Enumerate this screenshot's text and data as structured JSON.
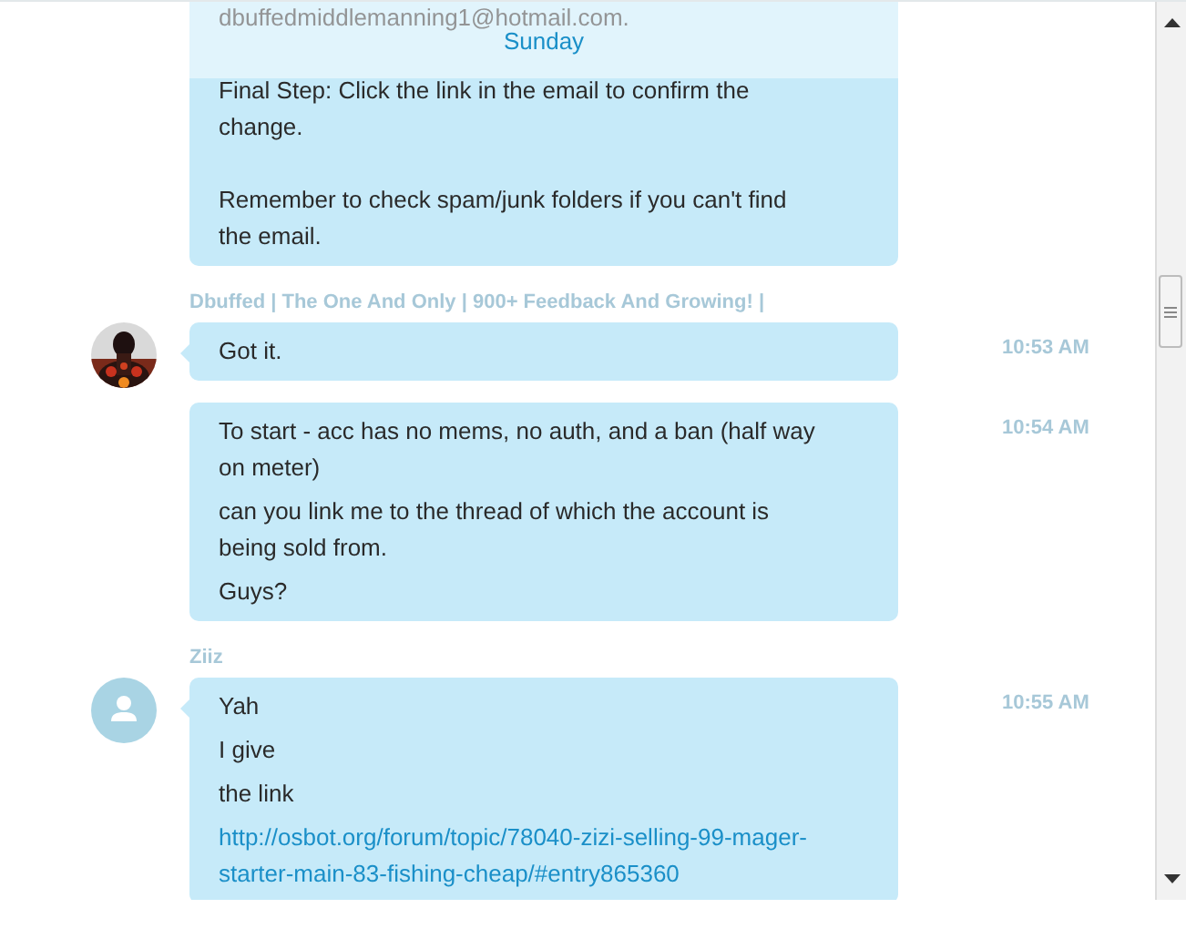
{
  "date_divider": "Sunday",
  "groups": [
    {
      "kind": "paragraphs",
      "bubbles": [
        {
          "messages": [
            {
              "kind": "text",
              "text": "dbuffedmiddlemanning1@hotmail.com."
            },
            {
              "kind": "text",
              "text": "Final Step: Click the link in the email to confirm the change."
            },
            {
              "kind": "text",
              "text": "Remember to check spam/junk folders if you can't find the email."
            }
          ]
        }
      ]
    },
    {
      "kind": "lines",
      "sender": "Dbuffed | The One And Only | 900+ Feedback And Growing! |",
      "avatar": {
        "kind": "picture"
      },
      "bubbles": [
        {
          "time": "10:53 AM",
          "messages": [
            {
              "kind": "text",
              "text": "Got it."
            }
          ]
        },
        {
          "time": "10:54 AM",
          "messages": [
            {
              "kind": "text",
              "text": "To start - acc has no mems, no auth, and a ban (half way on meter)"
            },
            {
              "kind": "text",
              "text": "can you link me to the thread of which the account is being sold from."
            },
            {
              "kind": "text",
              "text": "Guys?"
            }
          ]
        }
      ]
    },
    {
      "kind": "lines",
      "sender": "Ziiz",
      "avatar": {
        "kind": "default"
      },
      "bubbles": [
        {
          "time": "10:55 AM",
          "messages": [
            {
              "kind": "text",
              "text": "Yah"
            },
            {
              "kind": "text",
              "text": "I give"
            },
            {
              "kind": "text",
              "text": "the link"
            },
            {
              "kind": "link",
              "text": "http://osbot.org/forum/topic/78040-zizi-selling-99-mager-starter-main-83-fishing-cheap/#entry865360"
            }
          ]
        }
      ]
    }
  ]
}
